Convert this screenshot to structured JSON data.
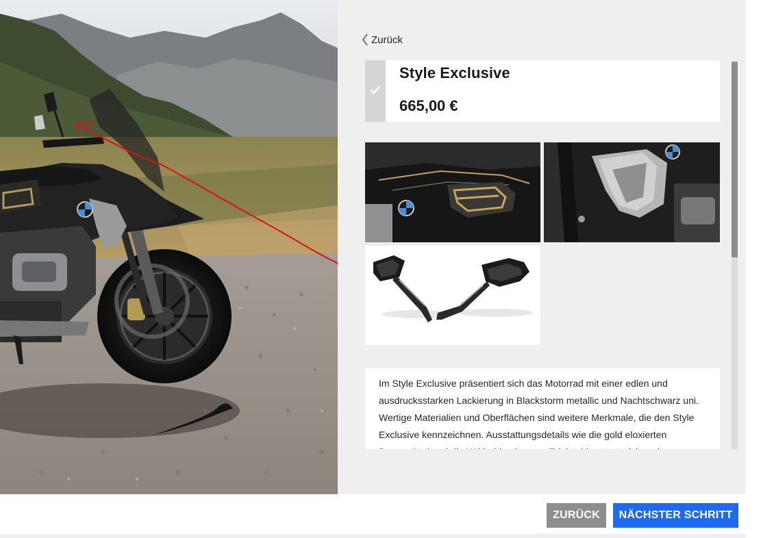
{
  "navigation": {
    "back_link_label": "Zurück"
  },
  "option": {
    "title": "Style Exclusive",
    "price": "665,00 €",
    "selected": true
  },
  "gallery": {
    "images": [
      "tank-decor",
      "radiator-cover",
      "mirrors"
    ]
  },
  "description": {
    "text": "Im Style Exclusive präsentiert sich das Motorrad mit einer edlen und ausdrucksstarken Lackierung in Blackstorm metallic und Nachtschwarz uni. Wertige Materialien und Oberflächen sind weitere Merkmale, die den Style Exclusive kennzeichnen. Ausstattungsdetails wie die gold eloxierten Bremssättel und die Kühlerblenden aus Edelstahl unterstreichen den"
  },
  "footer": {
    "back_button_label": "ZURÜCK",
    "next_button_label": "NÄCHSTER SCHRITT"
  },
  "colors": {
    "accent": "#1c69f5",
    "secondary_button": "#8e8e8e",
    "panel_background": "#efefef",
    "annotation": "#e01010"
  },
  "icons": {
    "back": "chevron-left-icon",
    "selected": "check-icon"
  }
}
